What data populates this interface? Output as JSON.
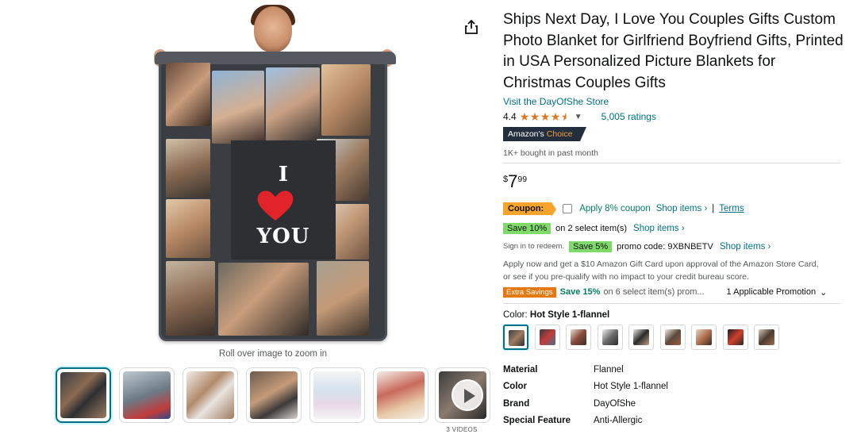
{
  "product": {
    "title": "Ships Next Day, I Love You Couples Gifts Custom Photo Blanket for Girlfriend Boyfriend Gifts, Printed in USA Personalized Picture Blankets for Christmas Couples Gifts",
    "store_link": "Visit the DayOfShe Store",
    "rating": "4.4",
    "ratings_count": "5,005 ratings",
    "badge_prefix": "Amazon's",
    "badge_suffix": "Choice",
    "bought_text": "1K+ bought in past month"
  },
  "blanket": {
    "word_top": "I",
    "word_bottom": "YOU"
  },
  "gallery": {
    "zoom_hint": "Roll over image to zoom in",
    "videos_label": "3 VIDEOS"
  },
  "price": {
    "symbol": "$",
    "whole": "7",
    "fraction": "99"
  },
  "coupon": {
    "badge": "Coupon:",
    "apply_text": "Apply 8% coupon",
    "shop_items": "Shop items ›",
    "separator": "|",
    "terms": "Terms"
  },
  "save10": {
    "badge": "Save 10%",
    "text": "on 2 select item(s)",
    "shop_items": "Shop items ›"
  },
  "save5": {
    "sign_in": "Sign in to redeem.",
    "badge": "Save 5%",
    "promo_text": "promo code: 9XBNBETV",
    "shop_items": "Shop items ›"
  },
  "gift_card": {
    "line1": "Apply now and get a $10 Amazon Gift Card upon approval of the Amazon Store Card,",
    "line2": "or see if you pre-qualify with no impact to your credit bureau score."
  },
  "extra": {
    "badge": "Extra Savings",
    "save": "Save 15%",
    "rest": "on 6 select item(s) prom...",
    "applicable": "1 Applicable Promotion"
  },
  "color": {
    "label": "Color:",
    "value": "Hot Style 1-flannel"
  },
  "specs": [
    {
      "key": "Material",
      "value": "Flannel"
    },
    {
      "key": "Color",
      "value": "Hot Style 1-flannel"
    },
    {
      "key": "Brand",
      "value": "DayOfShe"
    },
    {
      "key": "Special Feature",
      "value": "Anti-Allergic"
    }
  ],
  "colors": {
    "link": "#007185",
    "coupon_orange": "#f7a42c",
    "save_green": "#7fda69",
    "star": "#de7921",
    "badge_dark": "#232f3e"
  },
  "icons": {
    "share": "share-icon",
    "chevron": "chevron-down-icon",
    "play": "play-icon"
  }
}
